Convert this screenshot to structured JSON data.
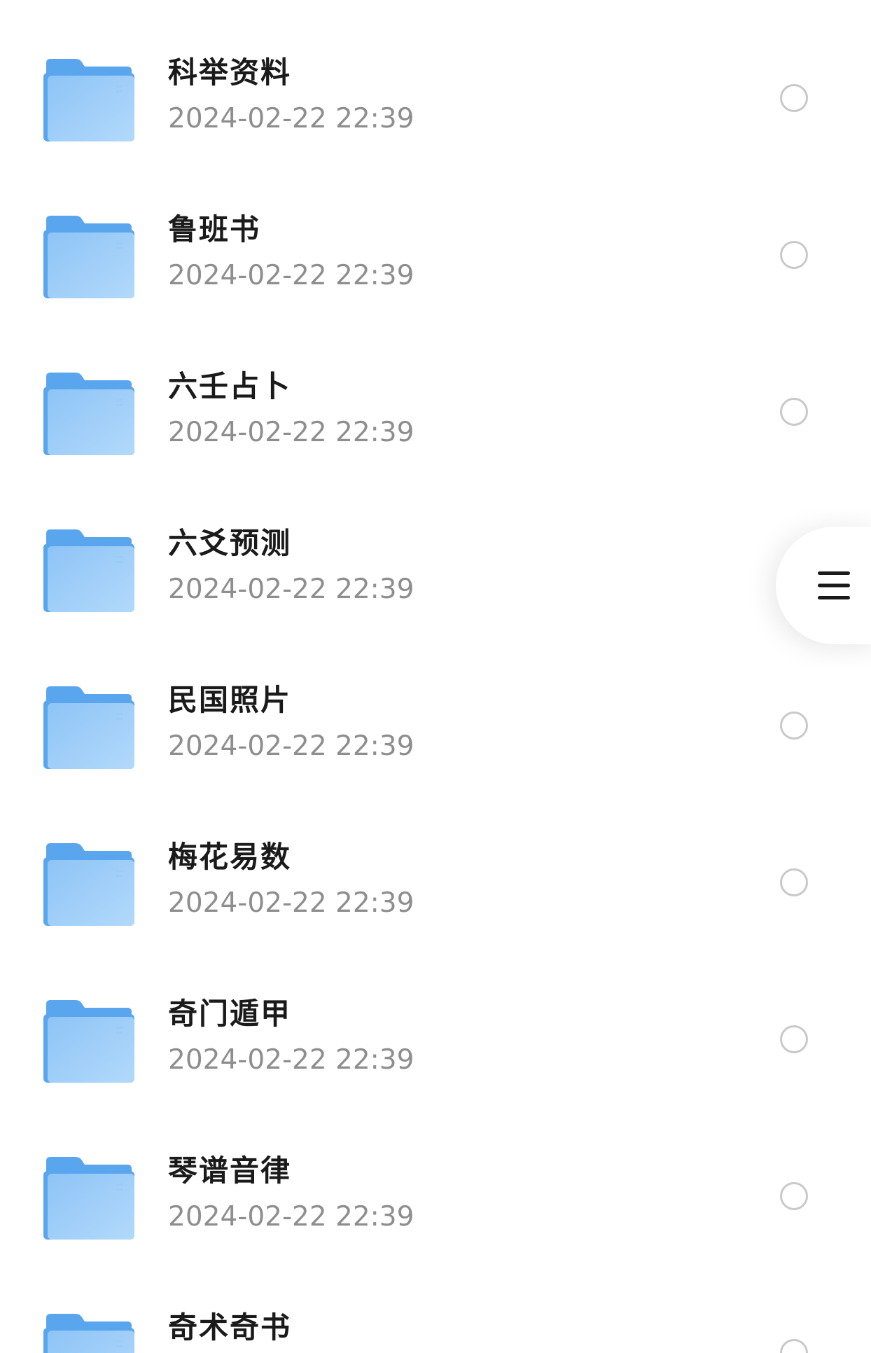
{
  "files": [
    {
      "name": "科举资料",
      "date": "2024-02-22 22:39",
      "icon": "folder-icon"
    },
    {
      "name": "鲁班书",
      "date": "2024-02-22 22:39",
      "icon": "folder-icon"
    },
    {
      "name": "六壬占卜",
      "date": "2024-02-22 22:39",
      "icon": "folder-icon"
    },
    {
      "name": "六爻预测",
      "date": "2024-02-22 22:39",
      "icon": "folder-icon"
    },
    {
      "name": "民国照片",
      "date": "2024-02-22 22:39",
      "icon": "folder-icon"
    },
    {
      "name": "梅花易数",
      "date": "2024-02-22 22:39",
      "icon": "folder-icon"
    },
    {
      "name": "奇门遁甲",
      "date": "2024-02-22 22:39",
      "icon": "folder-icon"
    },
    {
      "name": "琴谱音律",
      "date": "2024-02-22 22:39",
      "icon": "folder-icon"
    },
    {
      "name": "奇术奇书",
      "date": "",
      "icon": "folder-icon"
    }
  ],
  "side_handle": {
    "icon": "menu-icon"
  },
  "colors": {
    "folder_back": "#5AA6EE",
    "folder_front_top": "#8EC4F6",
    "folder_front_bottom": "#A9D3F9",
    "name_text": "#1a1a1a",
    "date_text": "#8e8e8e",
    "radio_border": "#c9c9c9"
  }
}
